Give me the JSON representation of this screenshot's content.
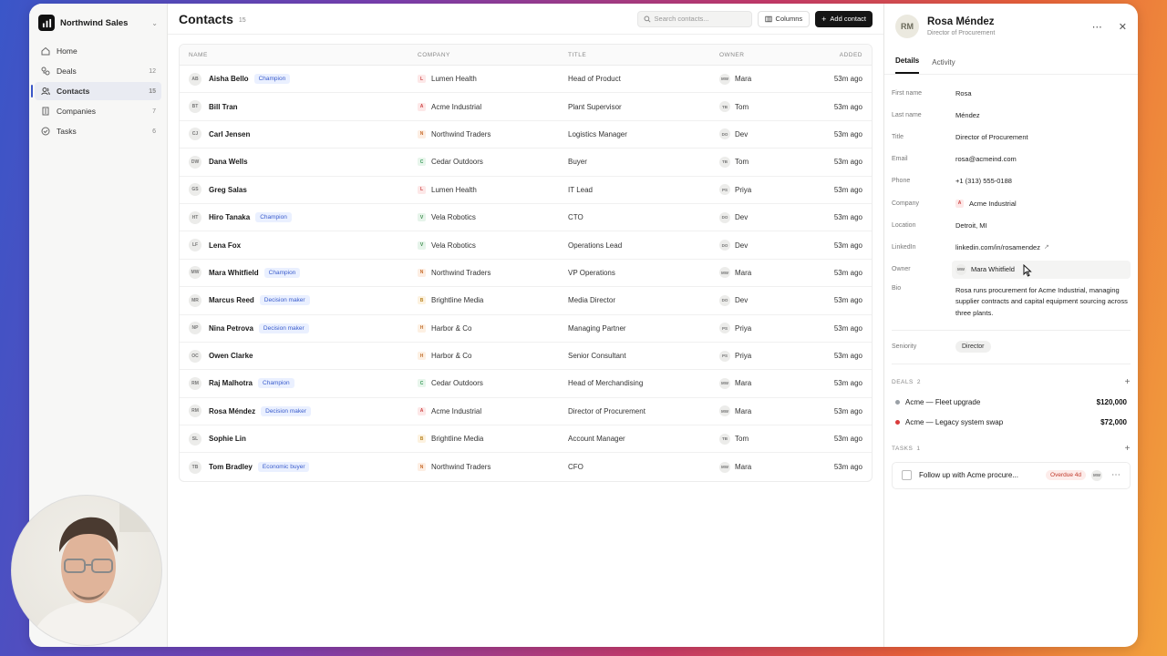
{
  "workspace": {
    "name": "Northwind Sales",
    "logo_icon": "northwind-logo-icon"
  },
  "sidebar": {
    "items": [
      {
        "label": "Home",
        "icon": "home-icon",
        "count": ""
      },
      {
        "label": "Deals",
        "icon": "deals-icon",
        "count": "12"
      },
      {
        "label": "Contacts",
        "icon": "contacts-icon",
        "count": "15"
      },
      {
        "label": "Companies",
        "icon": "building-icon",
        "count": "7"
      },
      {
        "label": "Tasks",
        "icon": "check-circle-icon",
        "count": "6"
      }
    ]
  },
  "header": {
    "title": "Contacts",
    "count": "15",
    "search_placeholder": "Search contacts...",
    "columns_label": "Columns",
    "add_label": "Add contact"
  },
  "table": {
    "columns": [
      "NAME",
      "COMPANY",
      "TITLE",
      "OWNER",
      "ADDED"
    ],
    "rows": [
      {
        "initials": "AB",
        "name": "Aisha Bello",
        "tag": "Champion",
        "company_initial": "L",
        "company": "Lumen Health",
        "title": "Head of Product",
        "owner_initials": "MW",
        "owner": "Mara",
        "added": "53m ago"
      },
      {
        "initials": "BT",
        "name": "Bill Tran",
        "tag": "",
        "company_initial": "A",
        "company": "Acme Industrial",
        "title": "Plant Supervisor",
        "owner_initials": "TB",
        "owner": "Tom",
        "added": "53m ago"
      },
      {
        "initials": "CJ",
        "name": "Carl Jensen",
        "tag": "",
        "company_initial": "N",
        "company": "Northwind Traders",
        "title": "Logistics Manager",
        "owner_initials": "DO",
        "owner": "Dev",
        "added": "53m ago"
      },
      {
        "initials": "DW",
        "name": "Dana Wells",
        "tag": "",
        "company_initial": "C",
        "company": "Cedar Outdoors",
        "title": "Buyer",
        "owner_initials": "TB",
        "owner": "Tom",
        "added": "53m ago"
      },
      {
        "initials": "GS",
        "name": "Greg Salas",
        "tag": "",
        "company_initial": "L",
        "company": "Lumen Health",
        "title": "IT Lead",
        "owner_initials": "PS",
        "owner": "Priya",
        "added": "53m ago"
      },
      {
        "initials": "HT",
        "name": "Hiro Tanaka",
        "tag": "Champion",
        "company_initial": "V",
        "company": "Vela Robotics",
        "title": "CTO",
        "owner_initials": "DO",
        "owner": "Dev",
        "added": "53m ago"
      },
      {
        "initials": "LF",
        "name": "Lena Fox",
        "tag": "",
        "company_initial": "V",
        "company": "Vela Robotics",
        "title": "Operations Lead",
        "owner_initials": "DO",
        "owner": "Dev",
        "added": "53m ago"
      },
      {
        "initials": "MW",
        "name": "Mara Whitfield",
        "tag": "Champion",
        "company_initial": "N",
        "company": "Northwind Traders",
        "title": "VP Operations",
        "owner_initials": "MW",
        "owner": "Mara",
        "added": "53m ago"
      },
      {
        "initials": "MR",
        "name": "Marcus Reed",
        "tag": "Decision maker",
        "company_initial": "B",
        "company": "Brightline Media",
        "title": "Media Director",
        "owner_initials": "DO",
        "owner": "Dev",
        "added": "53m ago"
      },
      {
        "initials": "NP",
        "name": "Nina Petrova",
        "tag": "Decision maker",
        "company_initial": "H",
        "company": "Harbor & Co",
        "title": "Managing Partner",
        "owner_initials": "PS",
        "owner": "Priya",
        "added": "53m ago"
      },
      {
        "initials": "OC",
        "name": "Owen Clarke",
        "tag": "",
        "company_initial": "H",
        "company": "Harbor & Co",
        "title": "Senior Consultant",
        "owner_initials": "PS",
        "owner": "Priya",
        "added": "53m ago"
      },
      {
        "initials": "RM",
        "name": "Raj Malhotra",
        "tag": "Champion",
        "company_initial": "C",
        "company": "Cedar Outdoors",
        "title": "Head of Merchandising",
        "owner_initials": "MW",
        "owner": "Mara",
        "added": "53m ago"
      },
      {
        "initials": "RM",
        "name": "Rosa Méndez",
        "tag": "Decision maker",
        "company_initial": "A",
        "company": "Acme Industrial",
        "title": "Director of Procurement",
        "owner_initials": "MW",
        "owner": "Mara",
        "added": "53m ago"
      },
      {
        "initials": "SL",
        "name": "Sophie Lin",
        "tag": "",
        "company_initial": "B",
        "company": "Brightline Media",
        "title": "Account Manager",
        "owner_initials": "TB",
        "owner": "Tom",
        "added": "53m ago"
      },
      {
        "initials": "TB",
        "name": "Tom Bradley",
        "tag": "Economic buyer",
        "company_initial": "N",
        "company": "Northwind Traders",
        "title": "CFO",
        "owner_initials": "MW",
        "owner": "Mara",
        "added": "53m ago"
      }
    ]
  },
  "detail": {
    "initials": "RM",
    "name": "Rosa Méndez",
    "subtitle": "Director of Procurement",
    "tabs": [
      "Details",
      "Activity"
    ],
    "fields": {
      "first_name": {
        "label": "First name",
        "value": "Rosa"
      },
      "last_name": {
        "label": "Last name",
        "value": "Méndez"
      },
      "title": {
        "label": "Title",
        "value": "Director of Procurement"
      },
      "email": {
        "label": "Email",
        "value": "rosa@acmeind.com"
      },
      "phone": {
        "label": "Phone",
        "value": "+1 (313) 555-0188"
      },
      "company": {
        "label": "Company",
        "initial": "A",
        "value": "Acme Industrial"
      },
      "location": {
        "label": "Location",
        "value": "Detroit, MI"
      },
      "linkedin": {
        "label": "LinkedIn",
        "value": "linkedin.com/in/rosamendez"
      },
      "owner": {
        "label": "Owner",
        "initials": "MW",
        "value": "Mara Whitfield"
      },
      "bio": {
        "label": "Bio",
        "value": "Rosa runs procurement for Acme Industrial, managing supplier contracts and capital equipment sourcing across three plants."
      },
      "seniority": {
        "label": "Seniority",
        "value": "Director"
      }
    },
    "deals": {
      "label": "DEALS",
      "count": "2",
      "items": [
        {
          "name": "Acme — Fleet upgrade",
          "amount": "$120,000",
          "color": "#9aa0a6"
        },
        {
          "name": "Acme — Legacy system swap",
          "amount": "$72,000",
          "color": "#d93b3b"
        }
      ]
    },
    "tasks": {
      "label": "TASKS",
      "count": "1",
      "items": [
        {
          "name": "Follow up with Acme procure...",
          "status": "Overdue 4d",
          "owner_initials": "MW"
        }
      ]
    }
  },
  "colors": {
    "accent": "#3a56c8",
    "tag_bg": "#eaf0ff",
    "tag_text": "#3a5ccc",
    "overdue": "#c0392b"
  }
}
